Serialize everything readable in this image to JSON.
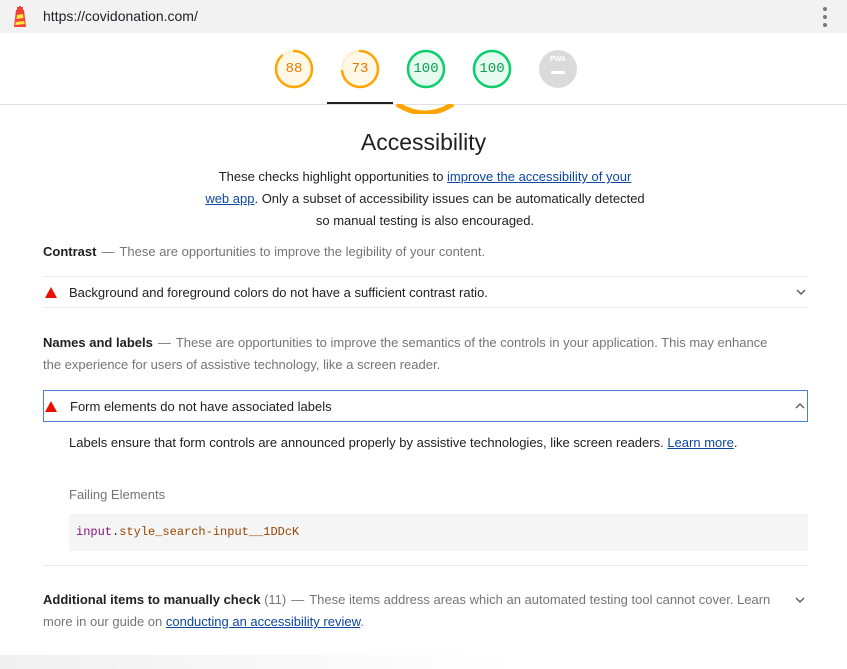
{
  "url": "https://covidonation.com/",
  "gauges": [
    {
      "score": "88",
      "value": 88,
      "kind": "orange",
      "color": "#ffa400"
    },
    {
      "score": "73",
      "value": 73,
      "kind": "orange",
      "color": "#ffa400"
    },
    {
      "score": "100",
      "value": 100,
      "kind": "green",
      "color": "#0cce6b"
    },
    {
      "score": "100",
      "value": 100,
      "kind": "green",
      "color": "#0cce6b"
    },
    {
      "score": "PWA",
      "value": 0,
      "kind": "pwa",
      "color": "#bdbdbd"
    }
  ],
  "category": {
    "title": "Accessibility",
    "desc_pre": "These checks highlight opportunities to ",
    "desc_link": "improve the accessibility of your web app",
    "desc_post": ". Only a subset of accessibility issues can be automatically detected so manual testing is also encouraged."
  },
  "groups": {
    "contrast": {
      "title": "Contrast",
      "desc": "These are opportunities to improve the legibility of your content."
    },
    "names": {
      "title": "Names and labels",
      "desc": "These are opportunities to improve the semantics of the controls in your application. This may enhance the experience for users of assistive technology, like a screen reader."
    }
  },
  "audits": {
    "contrast": {
      "title": "Background and foreground colors do not have a sufficient contrast ratio."
    },
    "labels": {
      "title": "Form elements do not have associated labels",
      "explanation": "Labels ensure that form controls are announced properly by assistive technologies, like screen readers. ",
      "learn_more": "Learn more",
      "period": ".",
      "failing_label": "Failing Elements",
      "node_tag": "input",
      "node_dot": ".",
      "node_class": "style_search-input__1DDcK"
    }
  },
  "manual": {
    "title": "Additional items to manually check",
    "count": "(11)",
    "desc": "These items address areas which an automated testing tool cannot cover. Learn more in our guide on ",
    "link": "conducting an accessibility review",
    "period": "."
  },
  "colors": {
    "fail": "#eb0f00",
    "average": "#ffa400",
    "pass": "#0cce6b",
    "link": "#0d47a1",
    "focus": "#4a7fd6"
  },
  "icons": {
    "logo": "lighthouse-logo-icon",
    "menu": "kebab-menu-icon",
    "fail": "fail-triangle-icon",
    "chevron": "chevron-icon"
  }
}
